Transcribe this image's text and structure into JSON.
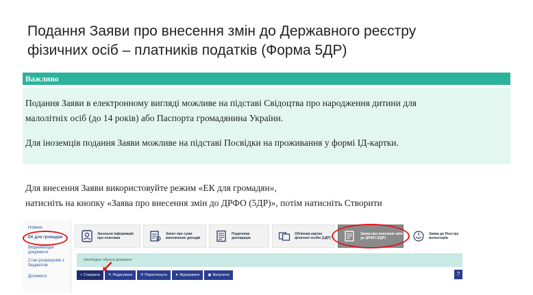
{
  "title": {
    "line1": "Подання Заяви про внесення змін до Державного реєстру",
    "line2": "фізичних осіб – платників податків (Форма 5ДР)"
  },
  "important": {
    "label": "Важливо",
    "paragraph1_line1": "Подання Заяви в електронному вигляді можливе на підставі Свідоцтва про народження дитини для",
    "paragraph1_line2": "малолітніх осіб (до 14 років) або Паспорта громадянина України.",
    "paragraph2": "Для іноземців подання Заяви можливе на підставі Посвідки на проживання у формі ІД-картки."
  },
  "instructions": {
    "line1": "Для внесення Заяви використовуйте режим «ЕК для громадян»,",
    "line2": "натисніть на кнопку  «Заява про внесення змін до ДРФО (5ДР)», потім натисніть Створити"
  },
  "screenshot": {
    "sidebar": [
      "Новини",
      "ЕК для громадян",
      "Вхідні/вихідні документи",
      "Стан розрахунків з бюджетом",
      "Допомога"
    ],
    "tiles": [
      "Загальна інформація про платника",
      "Запит про суми виплачених доходів",
      "Податкова декларація",
      "Облікова картка фізичної особи (1ДР)",
      "Заява про внесення змін до ДРФО (5ДР)",
      "Заява до Реєстру волонтерів"
    ],
    "notice": "Необхідно обрати документ",
    "toolbar": [
      "+ Створити",
      "Редагувати",
      "Переглянути",
      "Відправити",
      "Вилучити"
    ],
    "help": "?"
  },
  "colors": {
    "accent_bar": "#2ab39a",
    "info_bg": "#e3f7f1",
    "highlight": "#e0161b",
    "toolbar_btn": "#2a3d8f"
  }
}
